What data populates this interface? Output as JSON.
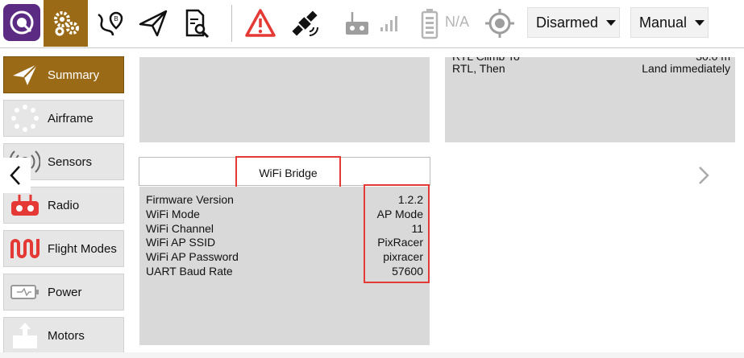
{
  "toolbar": {
    "battery_text": "N/A",
    "armed_select": {
      "value": "Disarmed"
    },
    "mode_select": {
      "value": "Manual"
    }
  },
  "sidebar": {
    "items": [
      {
        "label": "Summary",
        "icon": "paper-plane-icon",
        "active": true
      },
      {
        "label": "Airframe",
        "icon": "airframe-dots-icon"
      },
      {
        "label": "Sensors",
        "icon": "sensors-icon"
      },
      {
        "label": "Radio",
        "icon": "radio-controller-icon"
      },
      {
        "label": "Flight Modes",
        "icon": "flight-modes-icon"
      },
      {
        "label": "Power",
        "icon": "battery-icon"
      },
      {
        "label": "Motors",
        "icon": "motors-icon"
      }
    ]
  },
  "safety_panel": {
    "rtl_row": {
      "label": "RTL, Then",
      "value": "Land immediately"
    }
  },
  "wifi_panel": {
    "title": "WiFi Bridge",
    "rows": [
      {
        "label": "Firmware Version",
        "value": "1.2.2"
      },
      {
        "label": "WiFi Mode",
        "value": "AP Mode"
      },
      {
        "label": "WiFi Channel",
        "value": "11"
      },
      {
        "label": "WiFi AP SSID",
        "value": "PixRacer"
      },
      {
        "label": "WiFi AP Password",
        "value": "pixracer"
      },
      {
        "label": "UART Baud Rate",
        "value": "57600"
      }
    ]
  },
  "colors": {
    "accent": "#9a6a17",
    "logo_bg": "#5b2b83",
    "highlight": "#e53935",
    "warning": "#e53935"
  }
}
